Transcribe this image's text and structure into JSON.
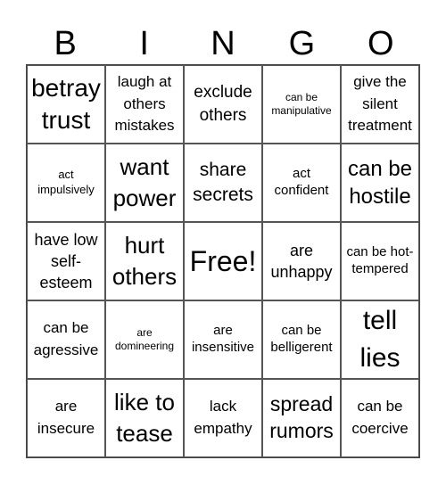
{
  "header": {
    "letters": [
      "B",
      "I",
      "N",
      "G",
      "O"
    ]
  },
  "cells": [
    "betray trust",
    "laugh at others mistakes",
    "exclude others",
    "can be manipulative",
    "give the silent treatment",
    "act impulsively",
    "want power",
    "share secrets",
    "act confident",
    "can be hostile",
    "have low self-esteem",
    "hurt others",
    "Free!",
    "are unhappy",
    "can be hot-tempered",
    "can be agressive",
    "are domineering",
    "are insensitive",
    "can be belligerent",
    "tell lies",
    "are insecure",
    "like to tease",
    "lack empathy",
    "spread rumors",
    "can be coercive"
  ]
}
